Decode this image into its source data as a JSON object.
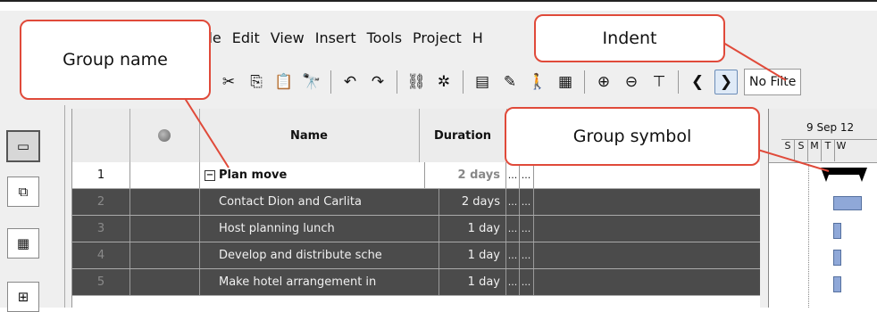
{
  "menu": [
    "File",
    "Edit",
    "View",
    "Insert",
    "Tools",
    "Project",
    "H"
  ],
  "toolbar": {
    "icons": [
      "cut-icon",
      "copy-icon",
      "paste-icon",
      "find-icon",
      "undo-icon",
      "redo-icon",
      "link-icon",
      "unlink-icon",
      "notes-icon",
      "highlight-icon",
      "assign-resources-icon",
      "table-icon",
      "zoom-in-icon",
      "zoom-out-icon",
      "filter-icon",
      "outdent-icon",
      "indent-icon"
    ],
    "filter_value": "No Filte"
  },
  "callouts": {
    "group_name": "Group name",
    "indent": "Indent",
    "group_symbol": "Group symbol"
  },
  "table": {
    "headers": {
      "name": "Name",
      "duration": "Duration"
    },
    "rows": [
      {
        "id": "1",
        "name": "Plan move",
        "duration": "2 days",
        "start": "...",
        "finish": "...",
        "is_group": true
      },
      {
        "id": "2",
        "name": "Contact Dion and Carlita",
        "duration": "2 days",
        "start": "...",
        "finish": "..."
      },
      {
        "id": "3",
        "name": "Host planning lunch",
        "duration": "1 day",
        "start": "...",
        "finish": "..."
      },
      {
        "id": "4",
        "name": "Develop and distribute sche",
        "duration": "1 day",
        "start": "...",
        "finish": "..."
      },
      {
        "id": "5",
        "name": "Make hotel arrangement in",
        "duration": "1 day",
        "start": "...",
        "finish": "..."
      }
    ]
  },
  "gantt": {
    "week_label": "9 Sep 12",
    "days": [
      "S",
      "S",
      "M",
      "T",
      "W"
    ]
  },
  "colors": {
    "callout_border": "#e04a3a",
    "selected_row": "#4b4b4b",
    "gantt_bar": "#000000",
    "task_bar": "#8fa8d8"
  }
}
